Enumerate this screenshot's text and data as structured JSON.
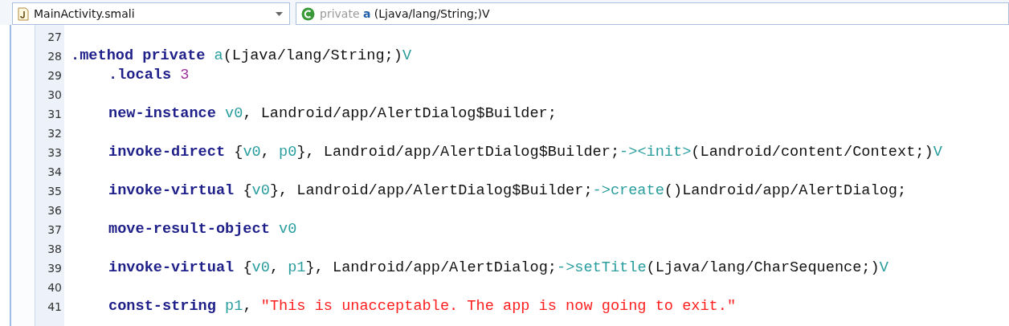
{
  "file_selector": {
    "label": "MainActivity.smali"
  },
  "member_selector": {
    "modifier": "private",
    "name": "a",
    "signature": "(Ljava/lang/String;)V"
  },
  "lines": [
    {
      "number": "27"
    },
    {
      "number": "28",
      "indented": false,
      "tokens": [
        {
          "kind": "keyword",
          "text": ".method private"
        },
        {
          "kind": "ref",
          "text": " a"
        },
        {
          "kind": "plain",
          "text": "(Ljava/lang/String;)"
        },
        {
          "kind": "ref",
          "text": "V"
        }
      ]
    },
    {
      "number": "29",
      "indented": true,
      "tokens": [
        {
          "kind": "keyword",
          "text": ".locals"
        },
        {
          "kind": "number",
          "text": " 3"
        }
      ]
    },
    {
      "number": "30"
    },
    {
      "number": "31",
      "indented": true,
      "tokens": [
        {
          "kind": "keyword",
          "text": "new-instance"
        },
        {
          "kind": "ref",
          "text": " v0"
        },
        {
          "kind": "plain",
          "text": ", Landroid/app/AlertDialog$Builder;"
        }
      ]
    },
    {
      "number": "32"
    },
    {
      "number": "33",
      "indented": true,
      "tokens": [
        {
          "kind": "keyword",
          "text": "invoke-direct"
        },
        {
          "kind": "plain",
          "text": " {"
        },
        {
          "kind": "ref",
          "text": "v0"
        },
        {
          "kind": "plain",
          "text": ", "
        },
        {
          "kind": "ref",
          "text": "p0"
        },
        {
          "kind": "plain",
          "text": "}, Landroid/app/AlertDialog$Builder;"
        },
        {
          "kind": "ref",
          "text": "-><init>"
        },
        {
          "kind": "plain",
          "text": "(Landroid/content/Context;)"
        },
        {
          "kind": "ref",
          "text": "V"
        }
      ]
    },
    {
      "number": "34"
    },
    {
      "number": "35",
      "indented": true,
      "tokens": [
        {
          "kind": "keyword",
          "text": "invoke-virtual"
        },
        {
          "kind": "plain",
          "text": " {"
        },
        {
          "kind": "ref",
          "text": "v0"
        },
        {
          "kind": "plain",
          "text": "}, Landroid/app/AlertDialog$Builder;"
        },
        {
          "kind": "ref",
          "text": "->create"
        },
        {
          "kind": "plain",
          "text": "()Landroid/app/AlertDialog;"
        }
      ]
    },
    {
      "number": "36"
    },
    {
      "number": "37",
      "indented": true,
      "tokens": [
        {
          "kind": "keyword",
          "text": "move-result-object"
        },
        {
          "kind": "ref",
          "text": " v0"
        }
      ]
    },
    {
      "number": "38"
    },
    {
      "number": "39",
      "indented": true,
      "tokens": [
        {
          "kind": "keyword",
          "text": "invoke-virtual"
        },
        {
          "kind": "plain",
          "text": " {"
        },
        {
          "kind": "ref",
          "text": "v0"
        },
        {
          "kind": "plain",
          "text": ", "
        },
        {
          "kind": "ref",
          "text": "p1"
        },
        {
          "kind": "plain",
          "text": "}, Landroid/app/AlertDialog;"
        },
        {
          "kind": "ref",
          "text": "->setTitle"
        },
        {
          "kind": "plain",
          "text": "(Ljava/lang/CharSequence;)"
        },
        {
          "kind": "ref",
          "text": "V"
        }
      ]
    },
    {
      "number": "40"
    },
    {
      "number": "41",
      "indented": true,
      "tokens": [
        {
          "kind": "keyword",
          "text": "const-string"
        },
        {
          "kind": "ref",
          "text": " p1"
        },
        {
          "kind": "plain",
          "text": ", "
        },
        {
          "kind": "string",
          "text": "\"This is unacceptable. The app is now going to exit.\""
        }
      ]
    }
  ]
}
